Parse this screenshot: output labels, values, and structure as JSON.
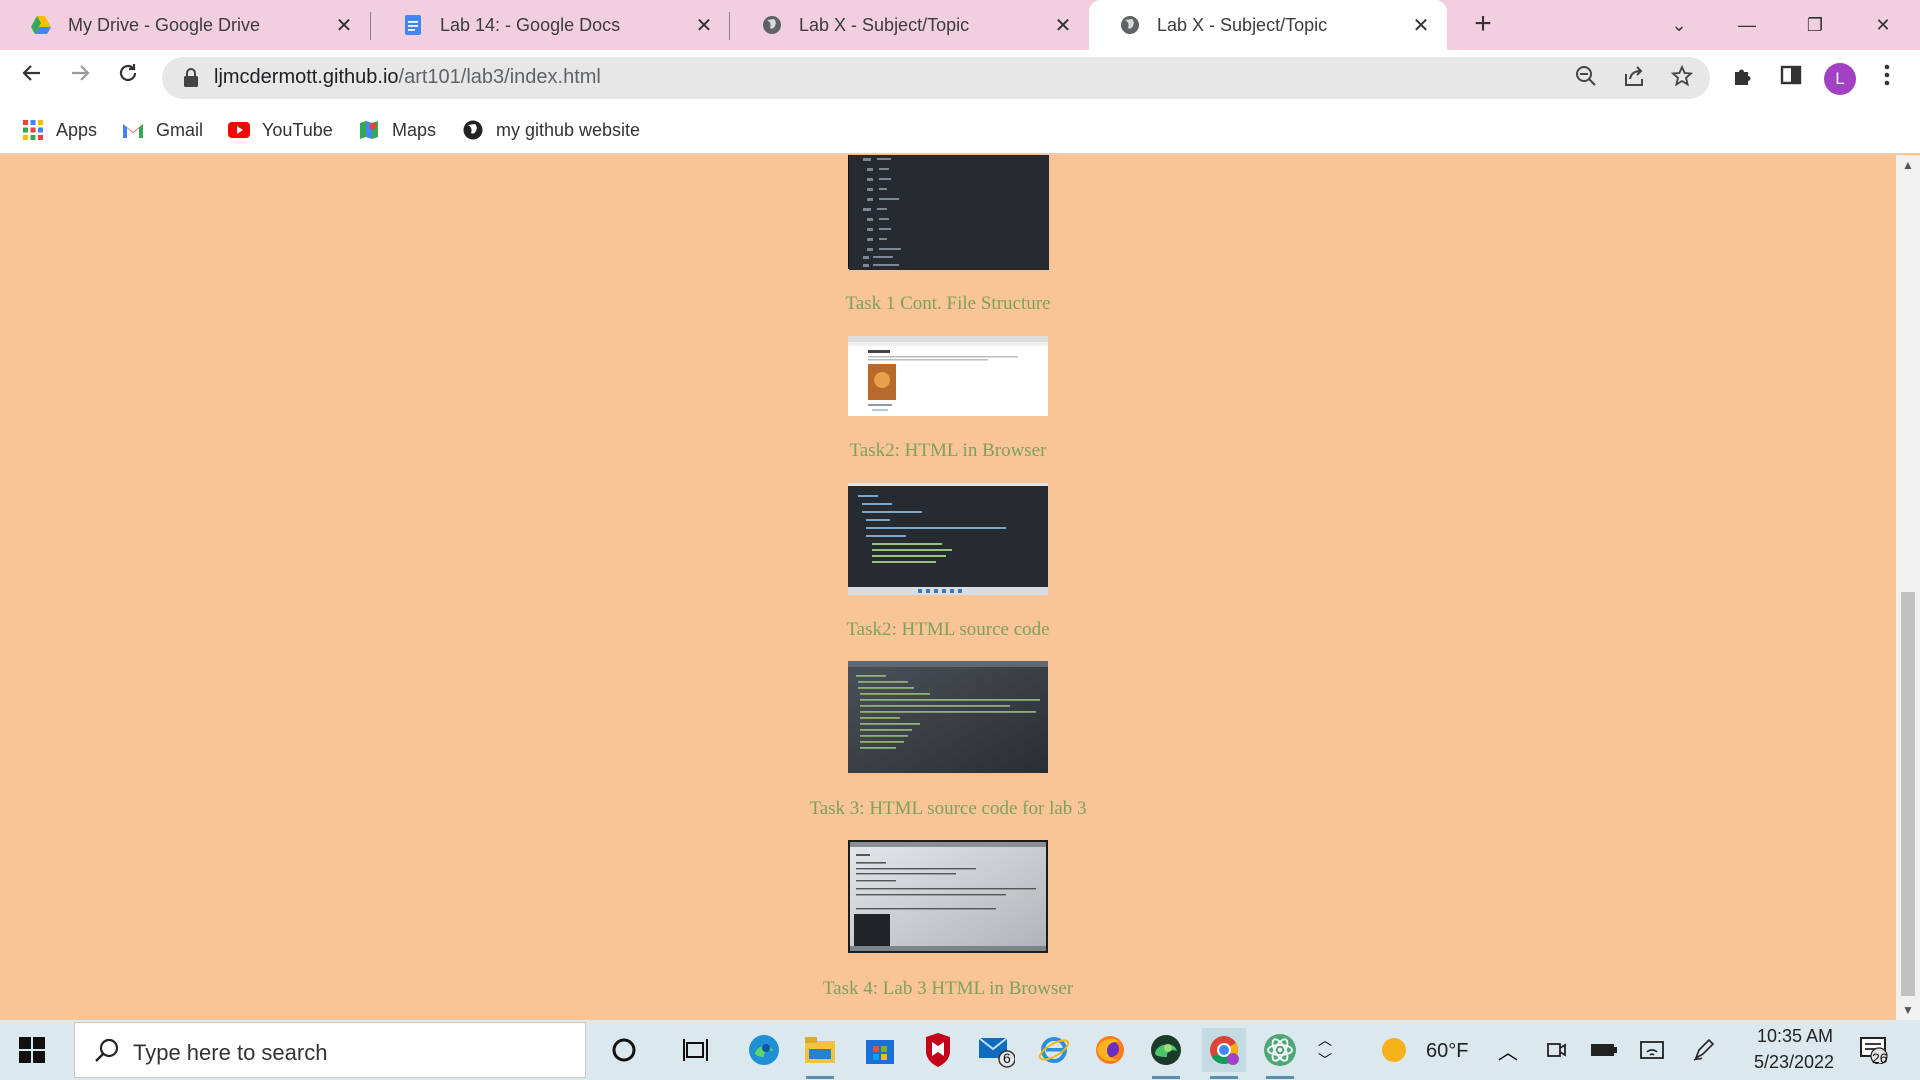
{
  "tabs": [
    {
      "title": "My Drive - Google Drive",
      "icon": "google-drive-icon"
    },
    {
      "title": "Lab 14: - Google Docs",
      "icon": "google-docs-icon"
    },
    {
      "title": "Lab X - Subject/Topic",
      "icon": "globe-icon"
    },
    {
      "title": "Lab X - Subject/Topic",
      "icon": "globe-icon",
      "active": true
    }
  ],
  "tab_close": "✕",
  "new_tab": "+",
  "window": {
    "chevron": "⌄",
    "minimize": "—",
    "restore": "❐",
    "close": "✕"
  },
  "address_bar": {
    "host": "ljmcdermott.github.io",
    "path": "/art101/lab3/index.html"
  },
  "profile_initial": "L",
  "bookmarks": [
    {
      "label": "Apps",
      "icon": "apps-grid-icon"
    },
    {
      "label": "Gmail",
      "icon": "gmail-icon"
    },
    {
      "label": "YouTube",
      "icon": "youtube-icon"
    },
    {
      "label": "Maps",
      "icon": "maps-icon"
    },
    {
      "label": "my github website",
      "icon": "github-icon"
    }
  ],
  "content": {
    "captions": [
      "Task 1 Cont. File Structure",
      "Task2: HTML in Browser",
      "Task2: HTML source code",
      "Task 3: HTML source code for lab 3",
      "Task 4: Lab 3 HTML in Browser"
    ],
    "background_color": "#f9c496",
    "caption_color": "#7fa05e"
  },
  "taskbar": {
    "search_placeholder": "Type here to search",
    "mail_badge": "6",
    "weather": "60°F",
    "time": "10:35 AM",
    "date": "5/23/2022",
    "notifications": "26"
  }
}
